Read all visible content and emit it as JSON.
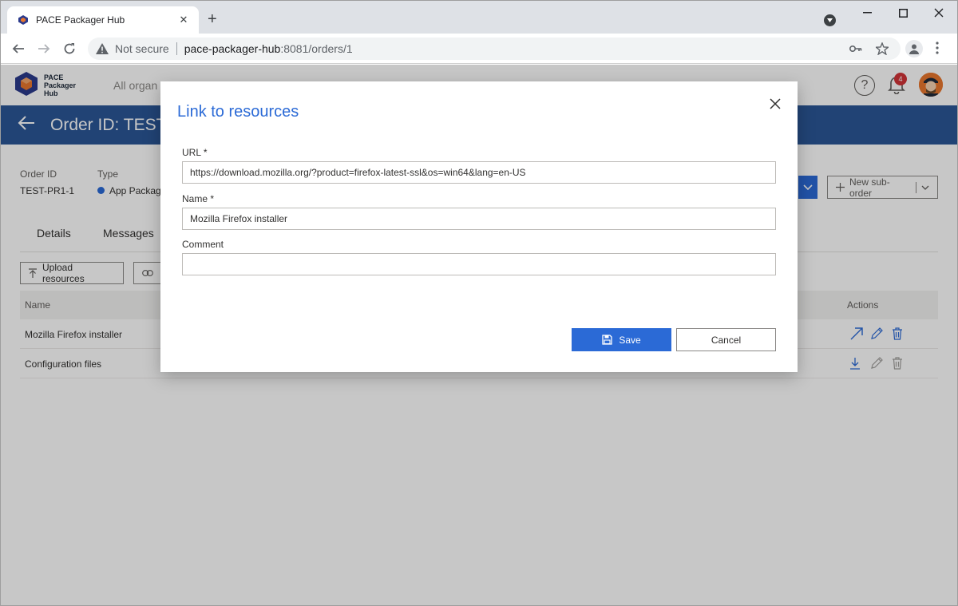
{
  "browser": {
    "tab_title": "PACE Packager Hub",
    "tab_close": "✕",
    "new_tab": "+",
    "not_secure": "Not secure",
    "url_host": "pace-packager-hub",
    "url_path": ":8081/orders/1"
  },
  "app": {
    "logo_lines": [
      "PACE",
      "Packager",
      "Hub"
    ],
    "org_selector": "All organ",
    "notifications_count": "4",
    "help_symbol": "?"
  },
  "page": {
    "title": "Order ID: TEST-",
    "info": {
      "order_id_label": "Order ID",
      "order_id_value": "TEST-PR1-1",
      "type_label": "Type",
      "type_value": "App Packag"
    },
    "tabs": [
      "Details",
      "Messages"
    ],
    "upload_button": "Upload resources",
    "new_suborder_button": "New sub-order",
    "grid": {
      "col_name": "Name",
      "col_actions": "Actions",
      "rows": [
        {
          "name": "Mozilla Firefox installer"
        },
        {
          "name": "Configuration files"
        }
      ]
    }
  },
  "modal": {
    "title": "Link to resources",
    "url_label": "URL *",
    "url_value": "https://download.mozilla.org/?product=firefox-latest-ssl&os=win64&lang=en-US",
    "name_label": "Name *",
    "name_value": "Mozilla Firefox installer",
    "comment_label": "Comment",
    "comment_value": "",
    "save_label": "Save",
    "cancel_label": "Cancel"
  },
  "colors": {
    "accent": "#2b6ad6",
    "title_bar": "#2b5797",
    "badge": "#d13438"
  }
}
